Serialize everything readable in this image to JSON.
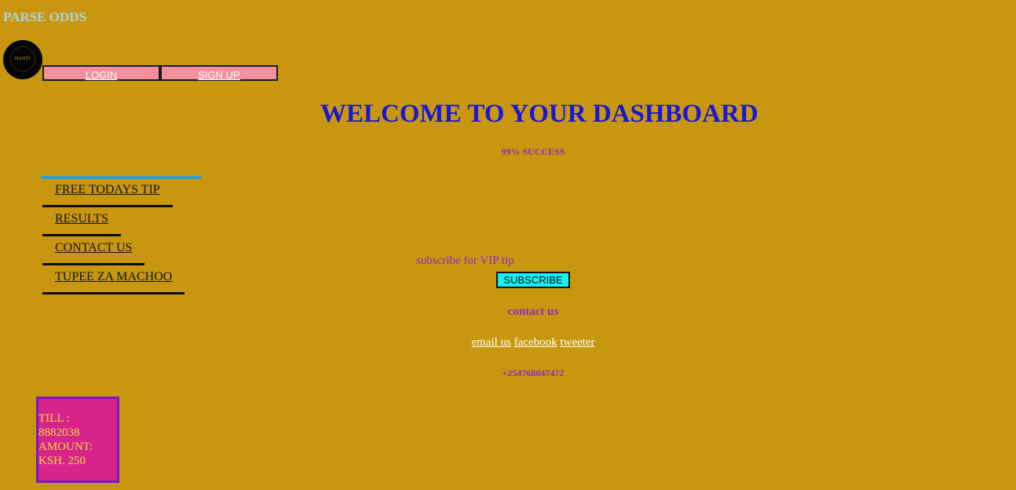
{
  "site": {
    "title": "PARSE ODDS",
    "logo_text": "HANTI"
  },
  "auth": {
    "login_label": "LOGIN",
    "signup_label": "SIGN UP"
  },
  "dashboard": {
    "headline": "WELCOME TO YOUR DASHBOARD",
    "tagline": "99% SUCCESS"
  },
  "nav": {
    "items": [
      {
        "label": "FREE TODAYS TIP"
      },
      {
        "label": "RESULTS"
      },
      {
        "label": "CONTACT US"
      },
      {
        "label": "TUPEE ZA MACHOO"
      }
    ]
  },
  "vip": {
    "text": "subscribe for VIP tip",
    "button_label": "SUBSCRIBE"
  },
  "contact": {
    "heading": "contact us",
    "links": [
      {
        "label": "email us"
      },
      {
        "label": "facebook"
      },
      {
        "label": "tweeter"
      }
    ],
    "phone": "+254768047472"
  },
  "payment": {
    "till_label": "TILL :",
    "till_number": "8882038",
    "amount_label": "AMOUNT:",
    "amount_value": "KSH. 250"
  },
  "colors": {
    "page_background": "#c9970f",
    "title_color": "#a8d3df",
    "headline_color": "#1818d6",
    "accent_purple": "#8e28c8",
    "auth_button_bg": "#f4909a",
    "subscribe_button_bg": "#18f0f5",
    "nav_top_bar": "#2fa2cf",
    "payment_box_bg": "#d8248a",
    "payment_text": "#e6e03c"
  }
}
